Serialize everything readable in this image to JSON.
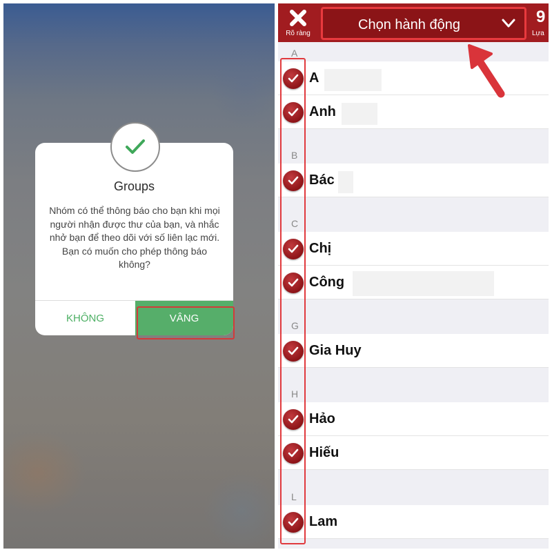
{
  "dialog": {
    "title": "Groups",
    "message": "Nhóm có thể thông báo cho bạn khi mọi người nhận được thư của bạn, và nhắc nhở bạn để theo dõi với số liên lạc mới. Bạn có muốn cho phép thông báo không?",
    "no_label": "KHÔNG",
    "yes_label": "VÂNG",
    "check_icon": "checkmark-icon"
  },
  "toolbar": {
    "clear_label": "Rõ ràng",
    "action_label": "Chọn hành động",
    "select_label": "Lựa"
  },
  "contacts": {
    "sections": [
      {
        "letter": "A",
        "items": [
          "A",
          "Anh"
        ]
      },
      {
        "letter": "B",
        "items": [
          "Bác"
        ]
      },
      {
        "letter": "C",
        "items": [
          "Chị",
          "Công"
        ]
      },
      {
        "letter": "G",
        "items": [
          "Gia Huy"
        ]
      },
      {
        "letter": "H",
        "items": [
          "Hảo",
          "Hiếu"
        ]
      },
      {
        "letter": "L",
        "items": [
          "Lam"
        ]
      }
    ]
  },
  "colors": {
    "accent_red": "#a11c20",
    "highlight_red": "#e0393d",
    "confirm_green": "#56ae6a"
  }
}
